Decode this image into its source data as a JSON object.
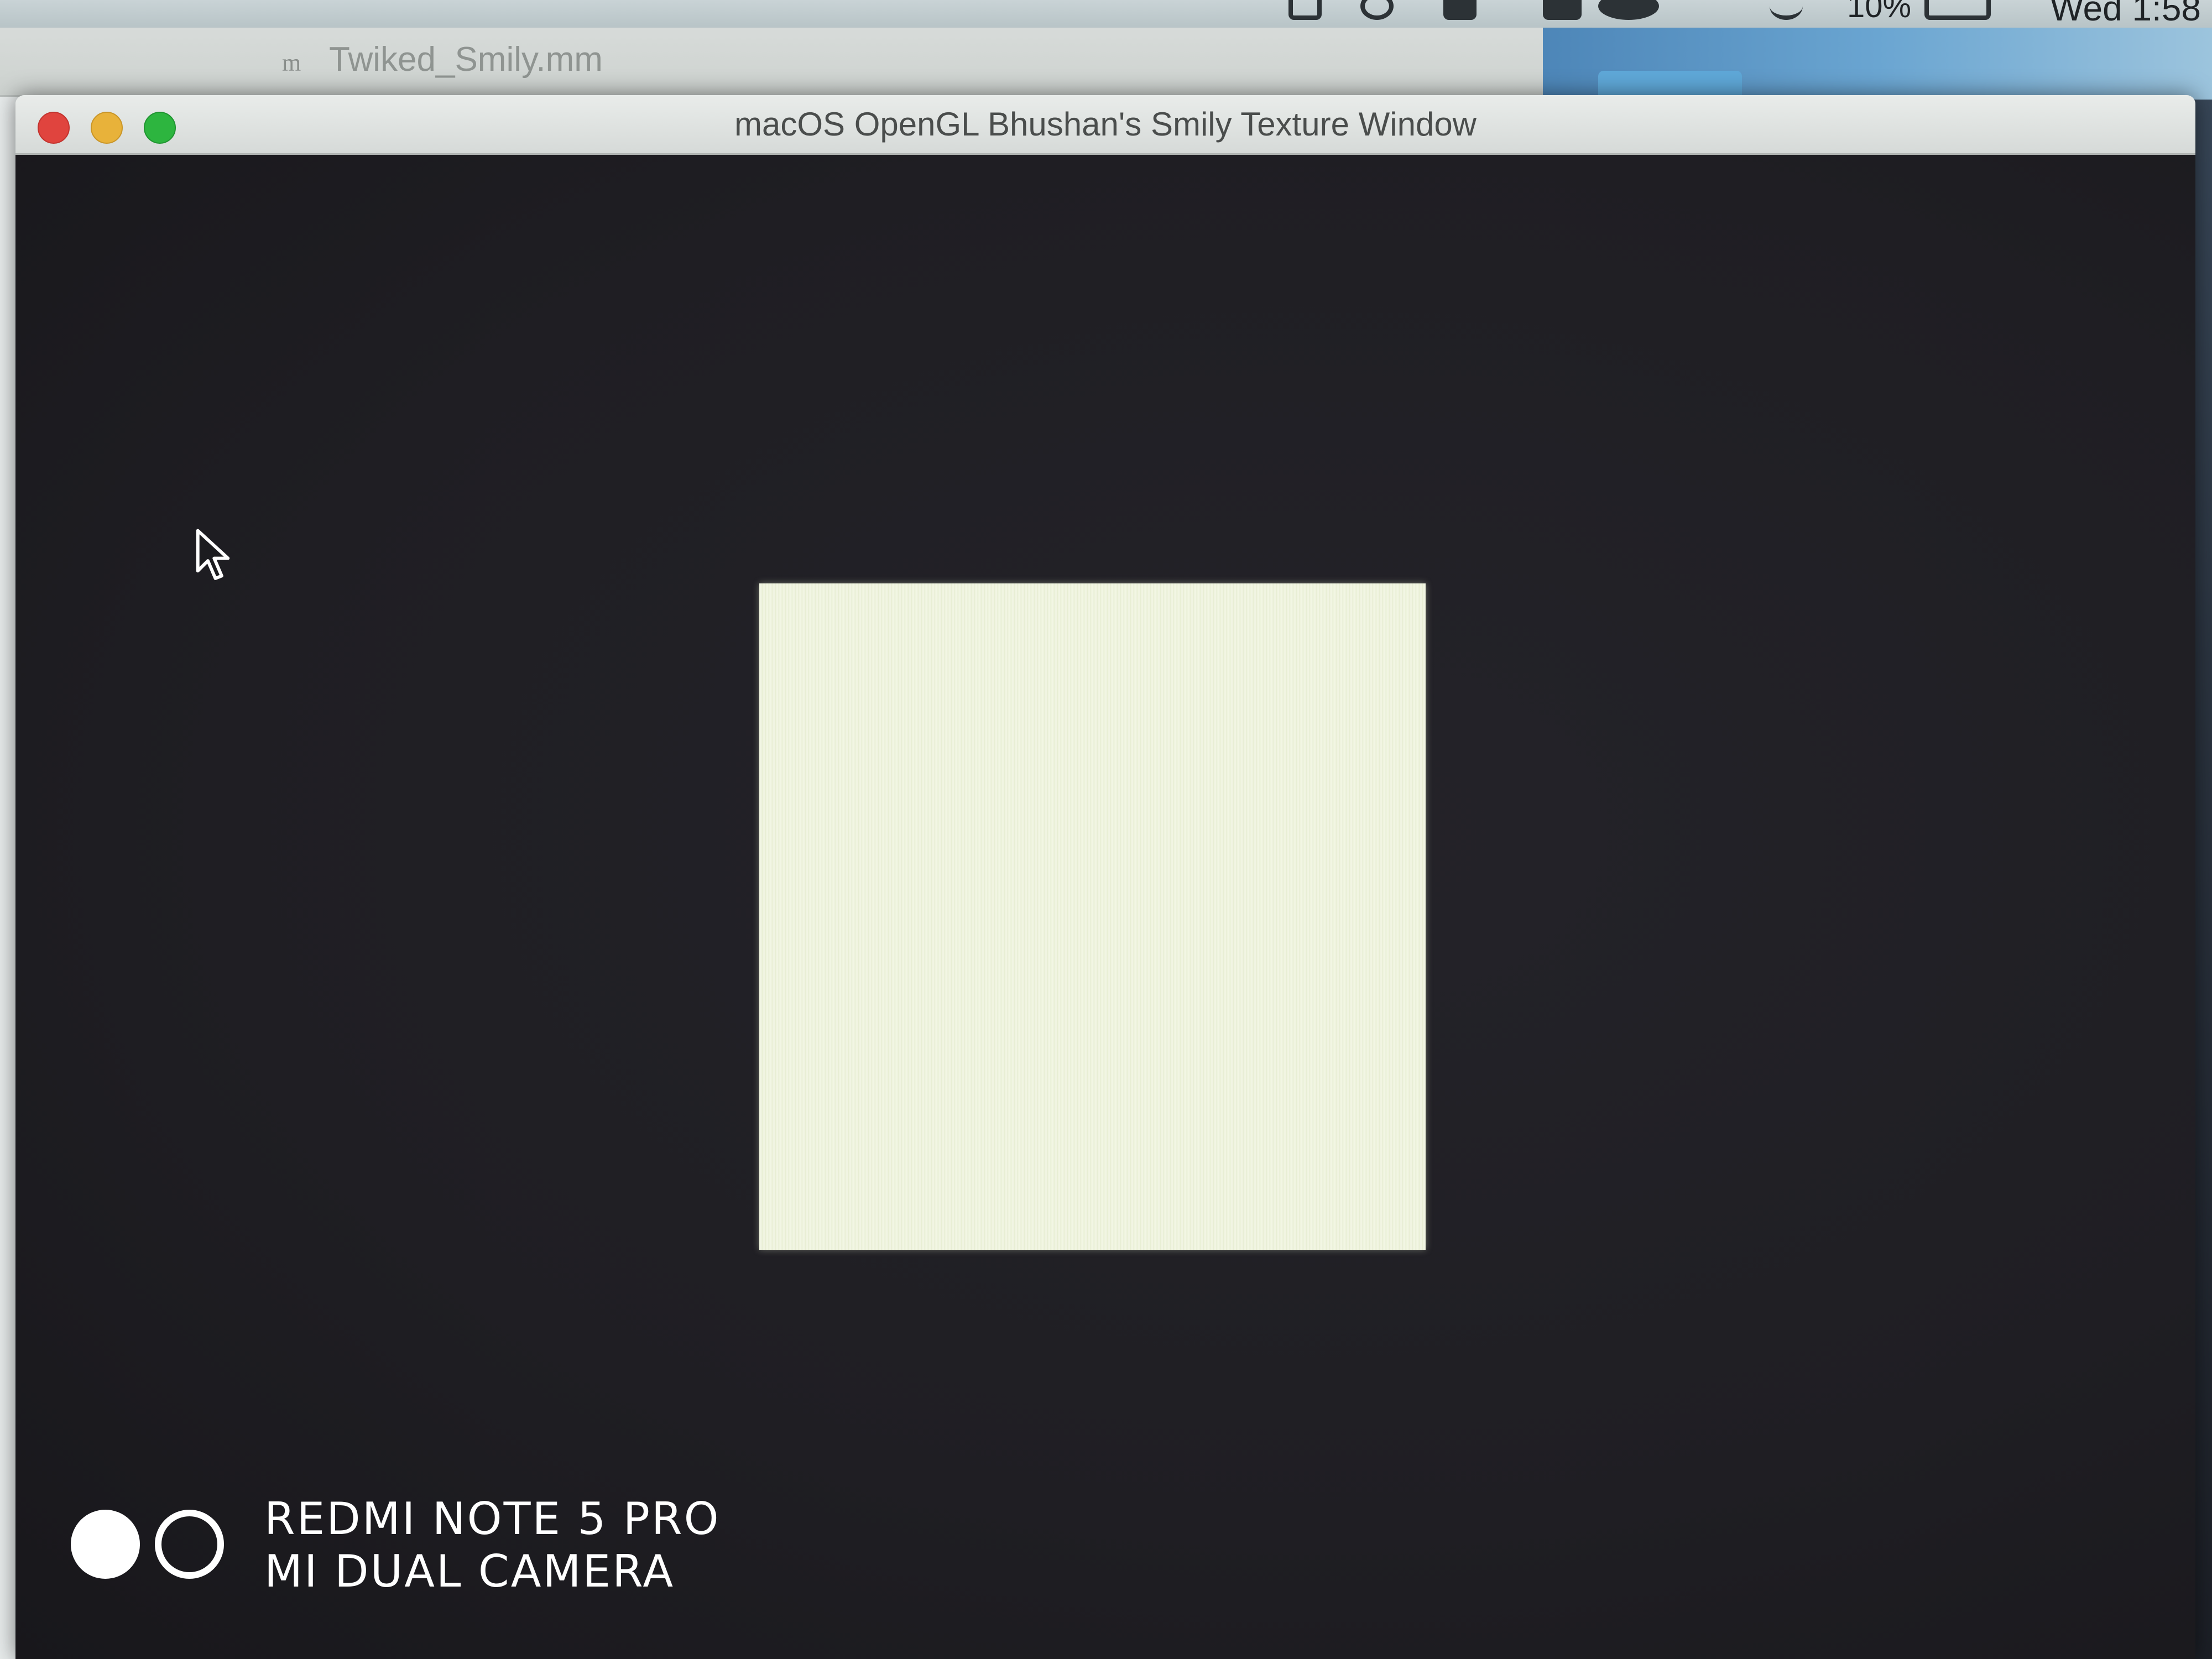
{
  "menubar": {
    "battery_percent": "10%",
    "clock": "Wed 1:58"
  },
  "editor": {
    "tab_icon": "m",
    "tab_label": "Twiked_Smily.mm"
  },
  "gl_window": {
    "title": "macOS OpenGL Bhushan's Smily Texture Window"
  },
  "watermark": {
    "line1": "REDMI NOTE 5 PRO",
    "line2": "MI DUAL CAMERA"
  },
  "colors": {
    "canvas_background": "#1f1e23",
    "quad_fill": "#eef3dc",
    "close": "#e0443e",
    "minimize": "#e8b23a",
    "maximize": "#2db53f"
  }
}
